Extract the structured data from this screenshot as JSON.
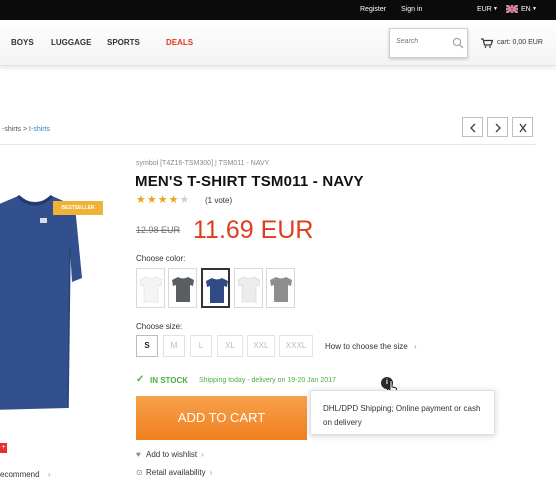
{
  "topbar": {
    "register": "Register",
    "signin": "Sign in",
    "currency": "EUR",
    "language": "EN",
    "flag_icon": "uk-flag-icon"
  },
  "nav": {
    "items": [
      "BOYS",
      "LUGGAGE",
      "SPORTS",
      "DEALS"
    ],
    "deals_color": "#e03c1e",
    "search_placeholder": "Search",
    "cart_label": "cart: 0,00 EUR"
  },
  "breadcrumb": {
    "prefix": "-shirts > ",
    "current": "t-shirts"
  },
  "product": {
    "bestseller_badge": "BESTSELLER",
    "sku": "symbol [T4Z16-TSM300] | TSM011 - NAVY",
    "title": "MEN'S T-SHIRT TSM011 - NAVY",
    "rating": 4,
    "rating_max": 5,
    "votes": "(1 vote)",
    "old_price": "12.98 EUR",
    "price": "11.69 EUR",
    "price_color": "#e03c1e",
    "choose_color_label": "Choose color:",
    "colors": [
      {
        "name": "white",
        "hex": "#f4f4f4",
        "selected": false
      },
      {
        "name": "graphite",
        "hex": "#5b5e61",
        "selected": false
      },
      {
        "name": "navy",
        "hex": "#2f4a86",
        "selected": true
      },
      {
        "name": "light-grey",
        "hex": "#ececec",
        "selected": false
      },
      {
        "name": "grey",
        "hex": "#8e8e8e",
        "selected": false
      }
    ],
    "choose_size_label": "Choose size:",
    "sizes": [
      {
        "label": "S",
        "available": true
      },
      {
        "label": "M",
        "available": false
      },
      {
        "label": "L",
        "available": false
      },
      {
        "label": "XL",
        "available": false
      },
      {
        "label": "XXL",
        "available": false
      },
      {
        "label": "XXXL",
        "available": false
      }
    ],
    "size_guide": "How to choose the size",
    "stock": "IN STOCK",
    "shipping": "Shipping today - delivery on 19-20 Jan 2017",
    "stock_color": "#4caf3e",
    "info_icon": "i",
    "tooltip": "DHL/DPD Shipping; Online payment or cash on delivery",
    "add_to_cart": "ADD TO CART",
    "cart_button_color": "#f28a2e",
    "wishlist": "Add to wishlist",
    "retail": "Retail availability"
  },
  "left": {
    "recommend": "ecommend",
    "badge_glyph": "+"
  }
}
